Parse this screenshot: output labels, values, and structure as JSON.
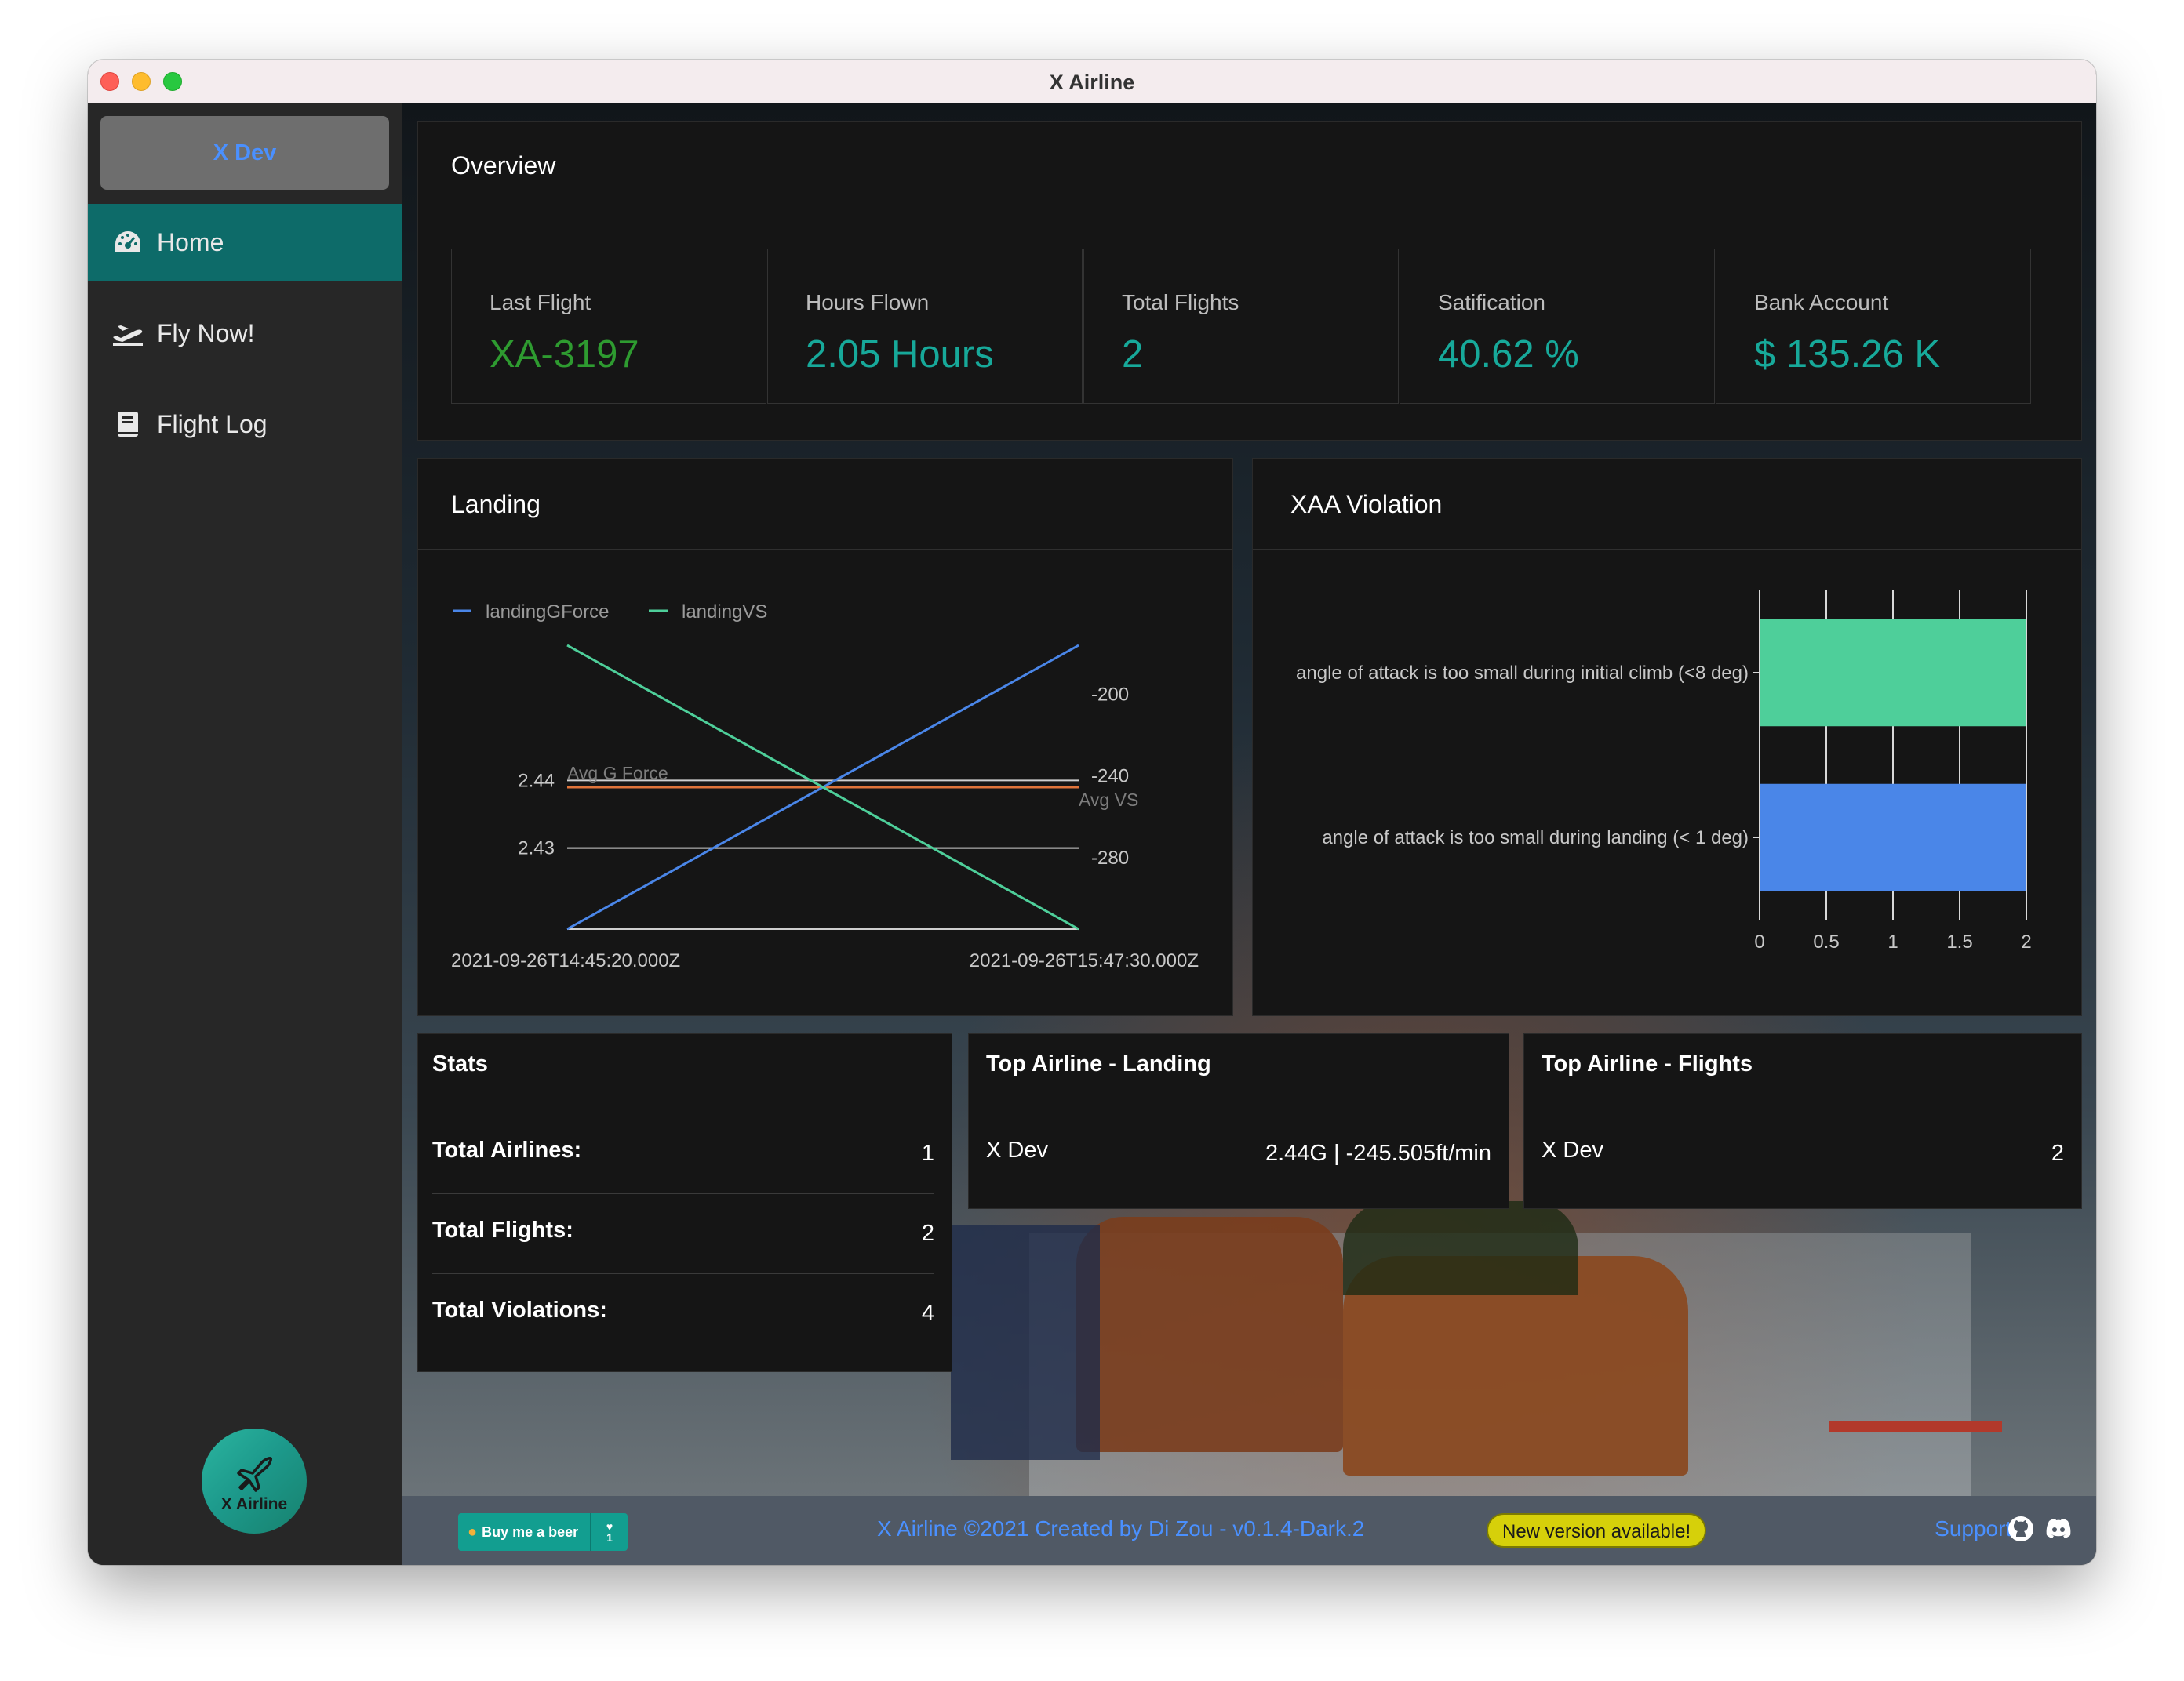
{
  "window": {
    "title": "X Airline"
  },
  "sidebar": {
    "profile": "X Dev",
    "items": [
      {
        "label": "Home",
        "icon": "dashboard-icon",
        "active": true
      },
      {
        "label": "Fly Now!",
        "icon": "plane-departure-icon",
        "active": false
      },
      {
        "label": "Flight Log",
        "icon": "book-icon",
        "active": false
      }
    ],
    "logo_text": "X Airline"
  },
  "overview": {
    "title": "Overview",
    "stats": [
      {
        "label": "Last Flight",
        "value": "XA-3197",
        "color": "#2e9b30"
      },
      {
        "label": "Hours Flown",
        "value": "2.05 Hours",
        "color": "#17a99a"
      },
      {
        "label": "Total Flights",
        "value": "2",
        "color": "#17a99a"
      },
      {
        "label": "Satification",
        "value": "40.62 %",
        "color": "#17a99a"
      },
      {
        "label": "Bank Account",
        "value": "$ 135.26 K",
        "color": "#17a99a"
      }
    ]
  },
  "landing": {
    "title": "Landing",
    "avg_g_label": "Avg G Force",
    "avg_vs_label": "Avg VS"
  },
  "violation": {
    "title": "XAA Violation"
  },
  "chart_data": [
    {
      "type": "line",
      "x": [
        "2021-09-26T14:45:20.000Z",
        "2021-09-26T15:47:30.000Z"
      ],
      "series": [
        {
          "name": "landingGForce",
          "axis": "left",
          "values": [
            2.418,
            2.46
          ],
          "color": "#4a86e8"
        },
        {
          "name": "landingVS",
          "axis": "right",
          "values": [
            -176,
            -315
          ],
          "color": "#4ecf9a"
        }
      ],
      "left_axis": {
        "ticks": [
          2.43,
          2.44
        ],
        "range": [
          2.418,
          2.46
        ]
      },
      "right_axis": {
        "ticks": [
          -200,
          -240,
          -280
        ],
        "range": [
          -315,
          -176
        ]
      },
      "reference_lines": [
        {
          "label": "Avg G Force",
          "value": 2.439
        },
        {
          "label": "Avg VS",
          "value": -245.505
        }
      ],
      "legend": "top-left"
    },
    {
      "type": "bar",
      "orientation": "horizontal",
      "categories": [
        "angle of attack is too small during initial climb (<8 deg)",
        "angle of attack is too small during landing (< 1 deg)"
      ],
      "values": [
        2,
        2
      ],
      "colors": [
        "#4ecf9a",
        "#4a86e8"
      ],
      "xlim": [
        0,
        2
      ],
      "xticks": [
        "0",
        "0.5",
        "1",
        "1.5",
        "2"
      ],
      "grid": true
    }
  ],
  "stats": {
    "title": "Stats",
    "rows": [
      {
        "label": "Total Airlines:",
        "value": "1"
      },
      {
        "label": "Total Flights:",
        "value": "2"
      },
      {
        "label": "Total Violations:",
        "value": "4"
      }
    ]
  },
  "top_landing": {
    "title": "Top Airline - Landing",
    "name": "X Dev",
    "value": "2.44G | -245.505ft/min"
  },
  "top_flights": {
    "title": "Top Airline - Flights",
    "name": "X Dev",
    "value": "2"
  },
  "footer": {
    "bmab_label": "Buy me a beer",
    "bmab_count": "1",
    "text": "X Airline ©2021 Created by Di Zou - v0.1.4-Dark.2",
    "new_version": "New version available!",
    "support": "Support:"
  }
}
